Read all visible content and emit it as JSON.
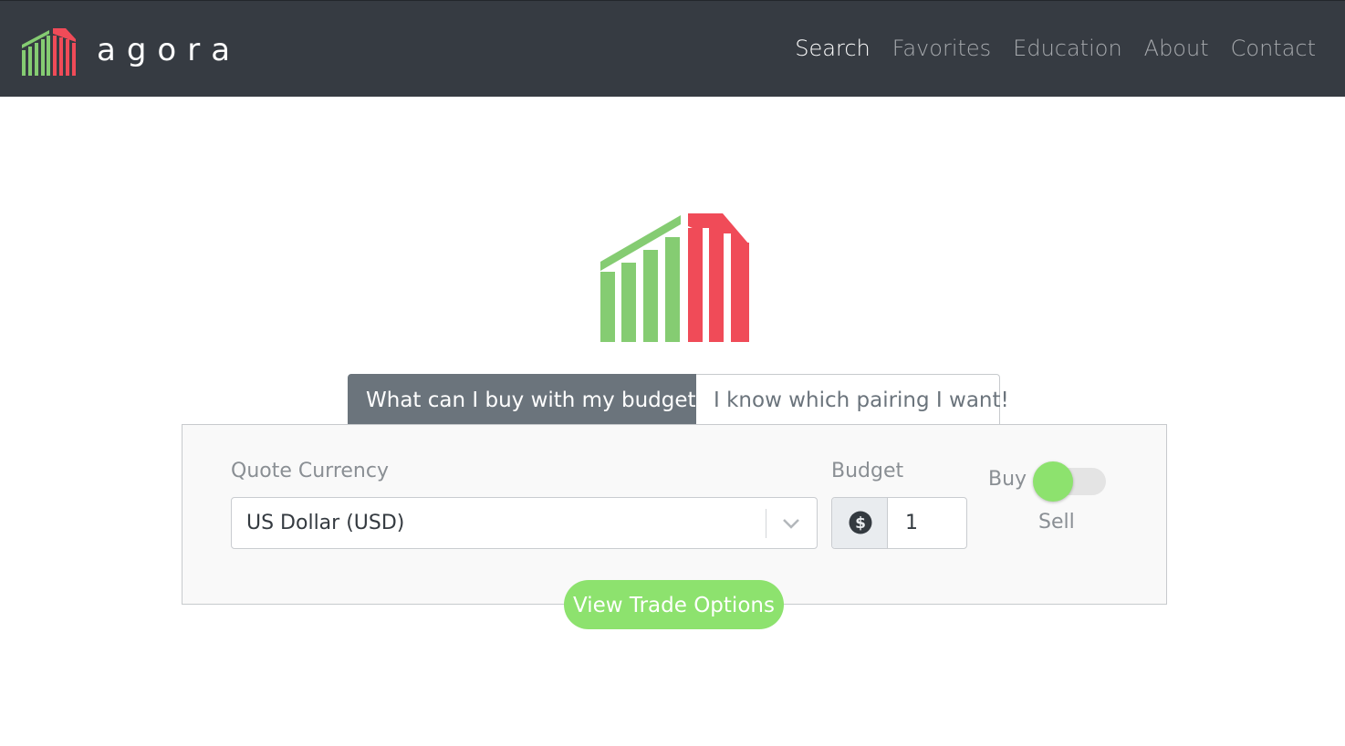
{
  "brand": {
    "name": "agora",
    "logo_icon": "agora-building-icon",
    "colors": {
      "green": "#85cc72",
      "red": "#f04b58"
    }
  },
  "nav": {
    "items": [
      {
        "label": "Search",
        "active": true
      },
      {
        "label": "Favorites",
        "active": false
      },
      {
        "label": "Education",
        "active": false
      },
      {
        "label": "About",
        "active": false
      },
      {
        "label": "Contact",
        "active": false
      }
    ]
  },
  "tabs": [
    {
      "label": "What can I buy with my budget?",
      "active": true
    },
    {
      "label": "I know which pairing I want!",
      "active": false
    }
  ],
  "form": {
    "quote_currency": {
      "label": "Quote Currency",
      "value": "US Dollar (USD)",
      "icon": "chevron-down-icon"
    },
    "budget": {
      "label": "Budget",
      "value": "1",
      "icon": "dollar-circle-icon"
    },
    "mode": {
      "buy_label": "Buy",
      "sell_label": "Sell",
      "selected": "Buy"
    },
    "submit_label": "View Trade Options"
  },
  "colors": {
    "navbar_bg": "#363b42",
    "accent_green": "#8de26e",
    "tab_active_bg": "#6b747c"
  }
}
